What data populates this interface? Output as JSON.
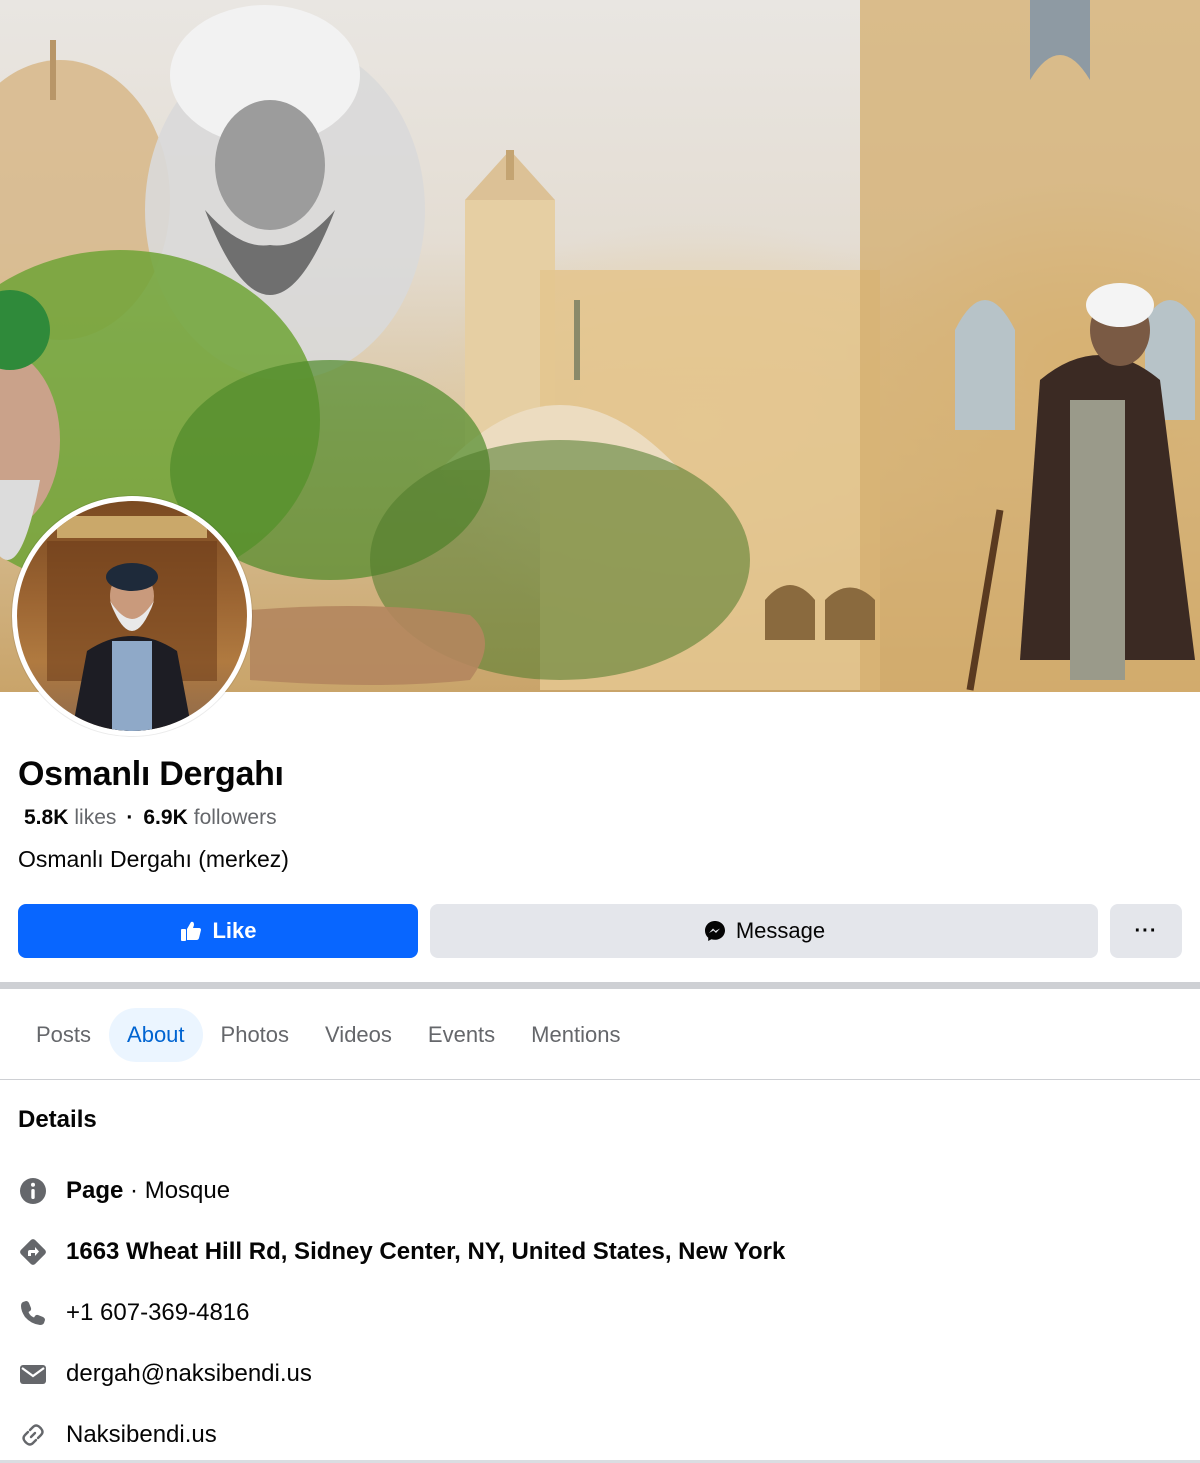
{
  "page": {
    "name": "Osmanlı Dergahı",
    "likes_count": "5.8K",
    "likes_label": "likes",
    "separator": "·",
    "followers_count": "6.9K",
    "followers_label": "followers",
    "category": "Osmanlı Dergahı (merkez)"
  },
  "actions": {
    "like_label": "Like",
    "message_label": "Message",
    "more_label": "···"
  },
  "tabs": [
    {
      "label": "Posts",
      "active": false
    },
    {
      "label": "About",
      "active": true
    },
    {
      "label": "Photos",
      "active": false
    },
    {
      "label": "Videos",
      "active": false
    },
    {
      "label": "Events",
      "active": false
    },
    {
      "label": "Mentions",
      "active": false
    }
  ],
  "details": {
    "title": "Details",
    "page_type_bold": "Page",
    "page_type_rest": " · Mosque",
    "address": "1663 Wheat Hill Rd, Sidney Center, NY, United States, New York",
    "phone": "+1 607-369-4816",
    "email": "dergah@naksibendi.us",
    "website": "Naksibendi.us"
  },
  "icons": {
    "info": "info-icon",
    "address": "directions-icon",
    "phone": "phone-icon",
    "email": "envelope-icon",
    "website": "link-icon",
    "like": "thumbs-up-icon",
    "message": "messenger-icon"
  },
  "colors": {
    "primary": "#0866ff",
    "secondary_button": "#e4e6eb",
    "active_tab_bg": "#ebf5ff",
    "active_tab_text": "#0064d1",
    "muted_text": "#65676b",
    "icon_gray": "#65676b"
  }
}
